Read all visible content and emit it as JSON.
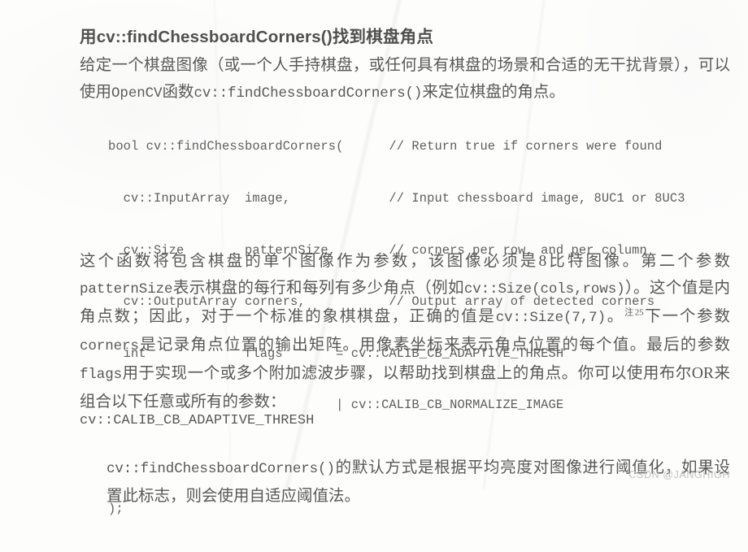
{
  "document": {
    "heading": "用cv::findChessboardCorners()找到棋盘角点",
    "intro_paragraph_part1": "给定一个棋盘图像（或一个人手持棋盘，或任何具有棋盘的场景和合适的无干扰背景），可以使用",
    "intro_paragraph_mono1": "OpenCV",
    "intro_paragraph_part2": "函数",
    "intro_paragraph_mono2": "cv::findChessboardCorners()",
    "intro_paragraph_part3": "来定位棋盘的角点。",
    "code": {
      "lines": [
        "bool cv::findChessboardCorners(      // Return true if corners were found",
        "  cv::InputArray  image,             // Input chessboard image, 8UC1 or 8UC3",
        "  cv::Size        patternSize,       // corners per row, and per column",
        "  cv::OutputArray corners,           // Output array of detected corners",
        "  int             flags       = cv::CALIB_CB_ADAPTIVE_THRESH",
        "                              | cv::CALIB_CB_NORMALIZE_IMAGE",
        "",
        ");"
      ]
    },
    "body_paragraph": {
      "s1": "这个函数将包含棋盘的单个图像作为参数，该图像必须是8比特图像。第二个参数",
      "m1": "patternSize",
      "s2": "表示棋盘的每行和每列有多少角点（例如",
      "m2": "cv::Size(cols,rows)",
      "s3": "）。这个值是内角点数；因此，对于一个标准的象棋棋盘，正确的值是",
      "m3": "cv::Size(7,7)",
      "s4": "。",
      "footnote": "注25",
      "s5": "下一个参数",
      "m4": "corners",
      "s6": "是记录角点位置的输出矩阵。用像素坐标来表示角点位置的每个值。最后的参数",
      "m5": "flags",
      "s7": "用于实现一个或多个附加滤波步骤，以帮助找到棋盘上的角点。你可以使用布尔OR来组合以下任意或所有的参数："
    },
    "flag_entry": {
      "term": "cv::CALIB_CB_ADAPTIVE_THRESH",
      "definition_mono": "cv::findChessboardCorners()",
      "definition_text": "的默认方式是根据平均亮度对图像进行阈值化，如果设置此标志，则会使用自适应阈值法。"
    },
    "watermark": "CSDN @JANGHIGH"
  }
}
